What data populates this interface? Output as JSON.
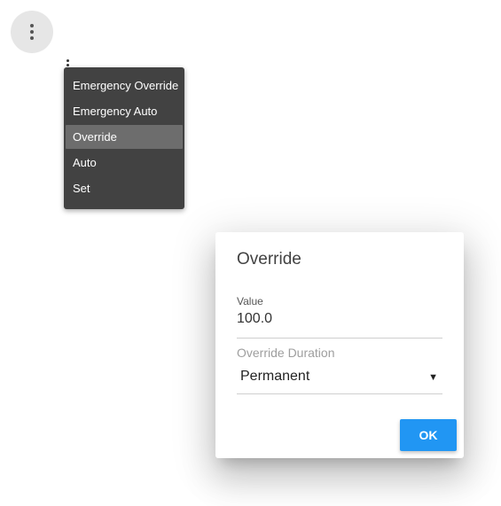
{
  "menu": {
    "items": [
      {
        "label": "Emergency Override"
      },
      {
        "label": "Emergency Auto"
      },
      {
        "label": "Override"
      },
      {
        "label": "Auto"
      },
      {
        "label": "Set"
      }
    ],
    "selected": "Override"
  },
  "dialog": {
    "title": "Override",
    "value_label": "Value",
    "value": "100.0",
    "duration_label": "Override Duration",
    "duration_value": "Permanent",
    "ok_label": "OK"
  },
  "icons": {
    "menu_button": "more-vert-icon",
    "select_arrow": "dropdown-arrow-icon"
  },
  "colors": {
    "menu_bg": "#424242",
    "menu_selected": "#6d6d6d",
    "primary": "#2196f3"
  }
}
